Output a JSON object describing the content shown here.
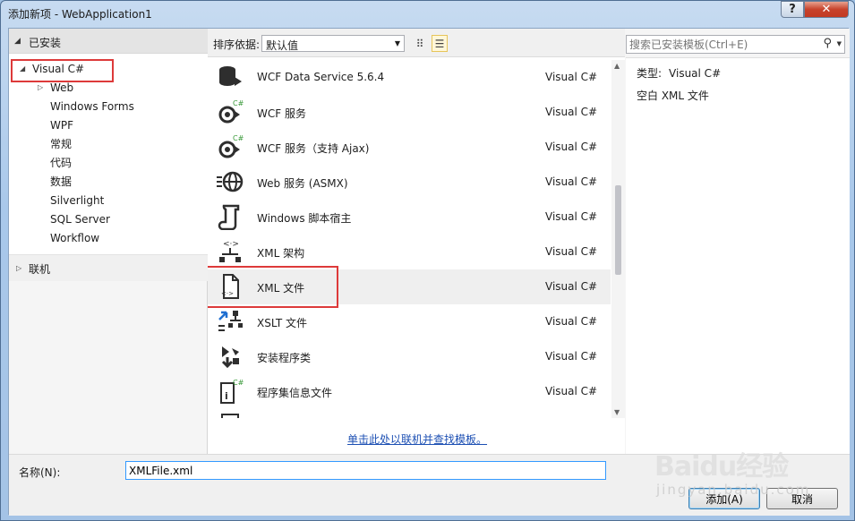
{
  "window": {
    "title": "添加新项 - WebApplication1",
    "help_label": "?",
    "close_label": "✕"
  },
  "tree": {
    "header": "已安装",
    "root": "Visual C#",
    "children": [
      "Web",
      "Windows Forms",
      "WPF",
      "常规",
      "代码",
      "数据",
      "Silverlight",
      "SQL Server",
      "Workflow"
    ],
    "online": "联机"
  },
  "sort": {
    "label": "排序依据:",
    "value": "默认值"
  },
  "templates": [
    {
      "name": "WCF Data Service 5.6.4",
      "lang": "Visual C#",
      "icon": "data-service-icon"
    },
    {
      "name": "WCF 服务",
      "lang": "Visual C#",
      "icon": "wcf-service-icon"
    },
    {
      "name": "WCF 服务（支持 Ajax)",
      "lang": "Visual C#",
      "icon": "wcf-ajax-service-icon"
    },
    {
      "name": "Web 服务 (ASMX)",
      "lang": "Visual C#",
      "icon": "web-service-globe-icon"
    },
    {
      "name": "Windows 脚本宿主",
      "lang": "Visual C#",
      "icon": "script-host-icon"
    },
    {
      "name": "XML 架构",
      "lang": "Visual C#",
      "icon": "xml-schema-icon"
    },
    {
      "name": "XML 文件",
      "lang": "Visual C#",
      "icon": "xml-file-icon",
      "selected": true
    },
    {
      "name": "XSLT 文件",
      "lang": "Visual C#",
      "icon": "xslt-file-icon"
    },
    {
      "name": "安装程序类",
      "lang": "Visual C#",
      "icon": "installer-class-icon"
    },
    {
      "name": "程序集信息文件",
      "lang": "Visual C#",
      "icon": "assembly-info-icon"
    }
  ],
  "online_link": "单击此处以联机并查找模板。",
  "search": {
    "placeholder": "搜索已安装模板(Ctrl+E)"
  },
  "details": {
    "type_label": "类型:",
    "type_value": "Visual C#",
    "description": "空白 XML 文件"
  },
  "name_field": {
    "label": "名称(N):",
    "value": "XMLFile.xml"
  },
  "buttons": {
    "add": "添加(A)",
    "cancel": "取消"
  },
  "watermark": {
    "line1": "Baidu经验",
    "line2": "jingyan.baidu.com"
  },
  "colors": {
    "highlight_box": "#dd3a3a",
    "link": "#1c4fb3",
    "close": "#c7422b"
  }
}
